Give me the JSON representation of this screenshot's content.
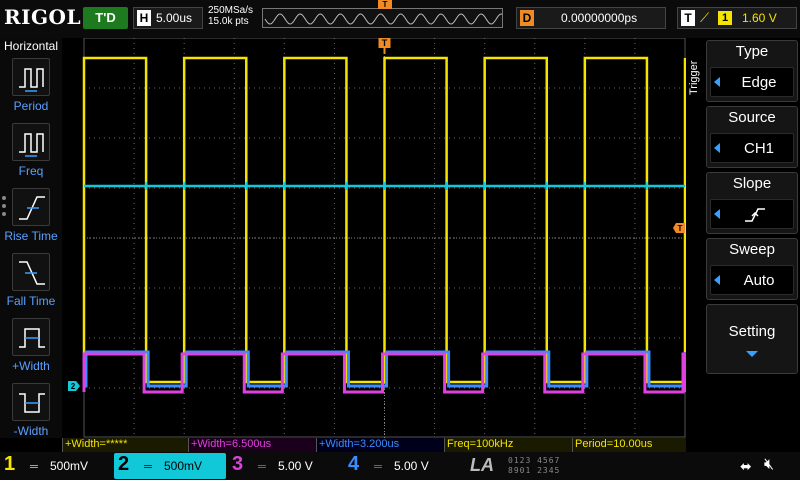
{
  "header": {
    "logo": "RIGOL",
    "run_state": "T'D",
    "horizontal": {
      "letter": "H",
      "timebase": "5.00us"
    },
    "sample_rate": "250MSa/s",
    "memory_depth": "15.0k pts",
    "trigger_pos_marker": "T",
    "delay": {
      "letter": "D",
      "value": "0.00000000ps"
    },
    "trigger": {
      "letter": "T",
      "edge_icon": "rising-edge",
      "source_num": "1",
      "level": "1.60 V"
    }
  },
  "left_menu": {
    "title": "Horizontal",
    "items": [
      {
        "label": "Period",
        "icon": "period-icon"
      },
      {
        "label": "Freq",
        "icon": "freq-icon"
      },
      {
        "label": "Rise Time",
        "icon": "rise-time-icon"
      },
      {
        "label": "Fall Time",
        "icon": "fall-time-icon"
      },
      {
        "label": "+Width",
        "icon": "pos-width-icon"
      },
      {
        "label": "-Width",
        "icon": "neg-width-icon"
      }
    ]
  },
  "right_menu": {
    "vertical_label": "Trigger",
    "items": [
      {
        "title": "Type",
        "value": "Edge"
      },
      {
        "title": "Source",
        "value": "CH1"
      },
      {
        "title": "Slope",
        "value": "rising-slope"
      },
      {
        "title": "Sweep",
        "value": "Auto"
      }
    ],
    "setting_label": "Setting"
  },
  "screen": {
    "trigger_marker": "T",
    "ch2_marker": "2",
    "level_marker": "T",
    "colors": {
      "ch1": "#f5e400",
      "ch2": "#10c8d8",
      "ch3": "#e040e0",
      "ch4": "#3a8dff",
      "grid": "#6a6a6a",
      "trigger": "#f08a24"
    },
    "ch1_high_frac": 0.05,
    "ch1_low_frac": 0.86
  },
  "measurements": [
    {
      "text": "+Width=*****"
    },
    {
      "text": "+Width=6.500us"
    },
    {
      "text": "+Width=3.200us"
    },
    {
      "text": "Freq=100kHz"
    },
    {
      "text": "Period=10.00us"
    }
  ],
  "channels": [
    {
      "num": "1",
      "scale": "500mV",
      "coupling_icon": "dc-coupling"
    },
    {
      "num": "2",
      "scale": "500mV",
      "coupling_icon": "dc-coupling"
    },
    {
      "num": "3",
      "scale": "5.00 V",
      "coupling_icon": "dc-coupling"
    },
    {
      "num": "4",
      "scale": "5.00 V",
      "coupling_icon": "dc-coupling"
    }
  ],
  "la": {
    "label": "LA",
    "row1": "0123 4567",
    "row2": "8901 2345"
  },
  "status_icons": [
    "usb-icon",
    "speaker-muted-icon"
  ]
}
